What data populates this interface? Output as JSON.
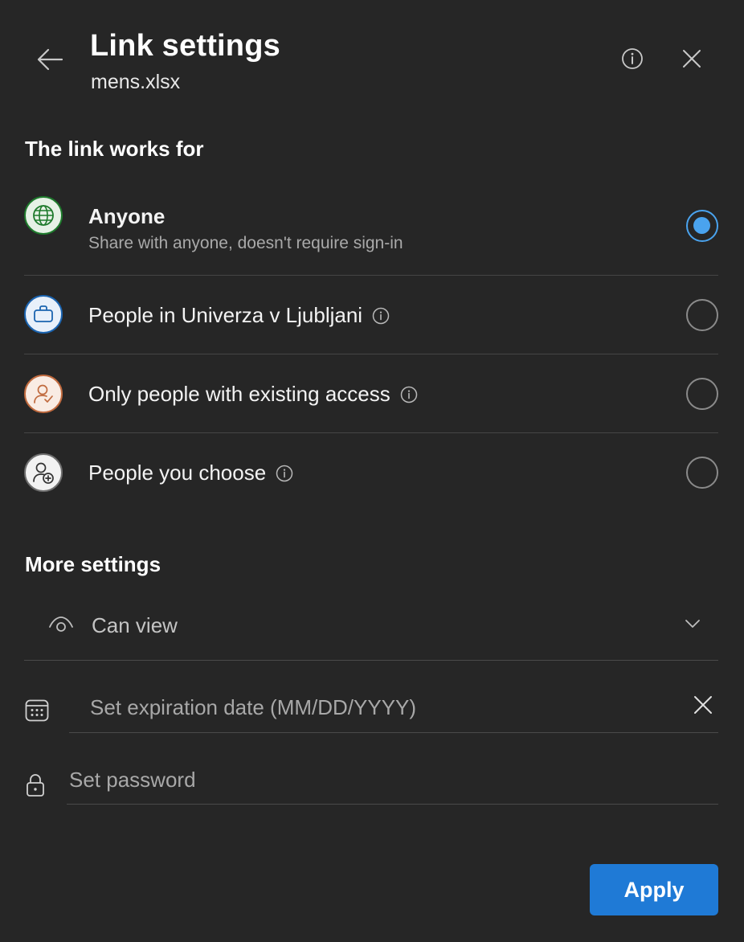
{
  "header": {
    "title": "Link settings",
    "filename": "mens.xlsx"
  },
  "link_section": {
    "title": "The link works for",
    "options": [
      {
        "label": "Anyone",
        "sublabel": "Share with anyone, doesn't require sign-in",
        "icon": "globe-icon",
        "selected": true,
        "has_info": false
      },
      {
        "label": "People in Univerza v Ljubljani",
        "icon": "briefcase-icon",
        "selected": false,
        "has_info": true
      },
      {
        "label": "Only people with existing access",
        "icon": "person-check-icon",
        "selected": false,
        "has_info": true
      },
      {
        "label": "People you choose",
        "icon": "person-add-icon",
        "selected": false,
        "has_info": true
      }
    ]
  },
  "more_settings": {
    "title": "More settings",
    "permission": "Can view",
    "expiration_placeholder": "Set expiration date (MM/DD/YYYY)",
    "password_placeholder": "Set password"
  },
  "footer": {
    "apply_label": "Apply"
  },
  "colors": {
    "background": "#262626",
    "accent": "#1f7ad6",
    "radio_selected": "#4aa3ee",
    "globe_green": "#1e7a2c",
    "briefcase_blue": "#1b64b0",
    "person_orange": "#c06a3e"
  }
}
